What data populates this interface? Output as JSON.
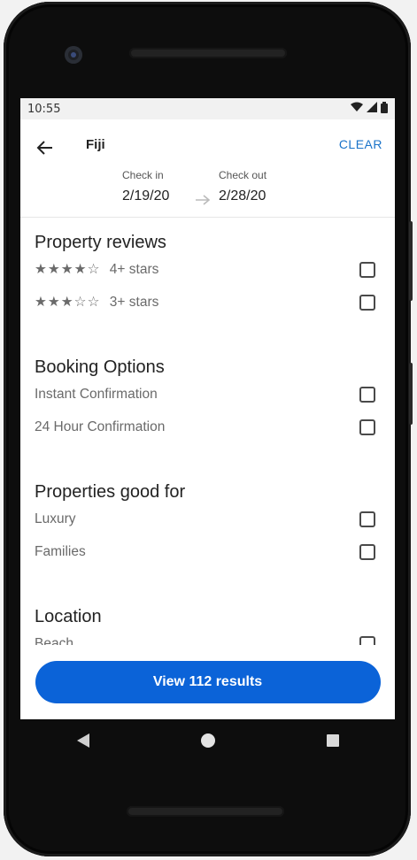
{
  "status": {
    "time": "10:55",
    "icons": [
      "wifi-icon",
      "signal-icon",
      "battery-icon"
    ]
  },
  "header": {
    "title": "Fiji",
    "clear_label": "CLEAR",
    "check_in_label": "Check in",
    "check_in_value": "2/19/20",
    "check_out_label": "Check out",
    "check_out_value": "2/28/20"
  },
  "filters": {
    "property_reviews": {
      "title": "Property reviews",
      "options": [
        {
          "stars": "★★★★☆",
          "label": "4+ stars"
        },
        {
          "stars": "★★★☆☆",
          "label": "3+ stars"
        }
      ]
    },
    "booking_options": {
      "title": "Booking Options",
      "options": [
        "Instant Confirmation",
        "24 Hour Confirmation"
      ]
    },
    "properties_good_for": {
      "title": "Properties good for",
      "options": [
        "Luxury",
        "Families"
      ]
    },
    "location": {
      "title": "Location",
      "options": [
        "Beach"
      ]
    }
  },
  "footer": {
    "cta_label": "View 112 results"
  },
  "colors": {
    "accent": "#0b63d8",
    "link": "#1a73c9"
  }
}
